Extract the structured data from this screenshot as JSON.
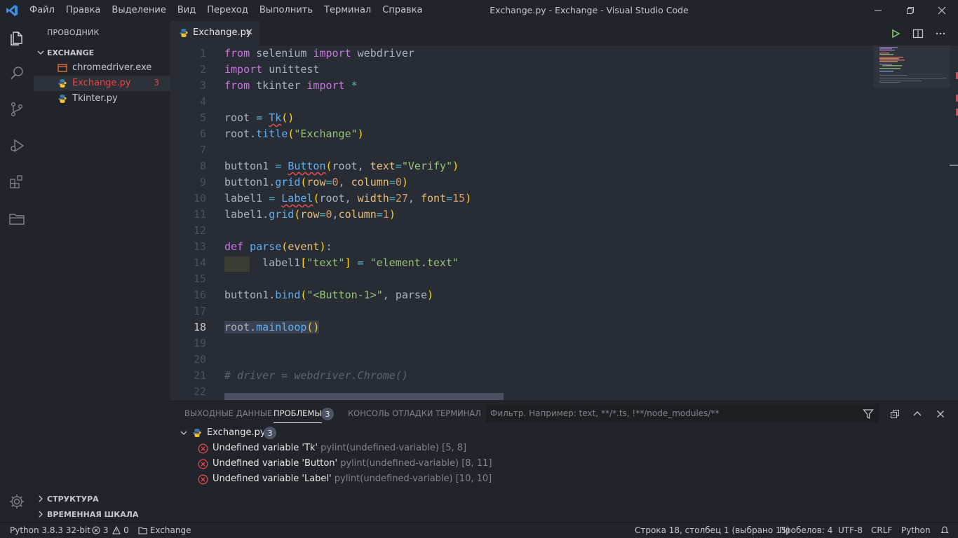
{
  "titlebar": {
    "menu": [
      "Файл",
      "Правка",
      "Выделение",
      "Вид",
      "Переход",
      "Выполнить",
      "Терминал",
      "Справка"
    ],
    "window_title": "Exchange.py - Exchange - Visual Studio Code"
  },
  "activitybar": {
    "items": [
      "explorer-icon",
      "search-icon",
      "source-control-icon",
      "run-debug-icon",
      "extensions-icon",
      "folder-icon"
    ],
    "bottom": "gear-icon"
  },
  "sidebar": {
    "title": "ПРОВОДНИК",
    "folder": "EXCHANGE",
    "files": [
      {
        "name": "chromedriver.exe",
        "icon": "exe-file-icon",
        "error": false
      },
      {
        "name": "Exchange.py",
        "icon": "python-icon",
        "error": true,
        "count": "3"
      },
      {
        "name": "Tkinter.py",
        "icon": "python-icon",
        "error": false
      }
    ],
    "outline": "СТРУКТУРА",
    "timeline": "ВРЕМЕННАЯ ШКАЛА"
  },
  "tabs": {
    "active": "Exchange.py",
    "actions": [
      "run-icon",
      "split-editor-icon",
      "more-icon"
    ]
  },
  "editor": {
    "line_numbers": [
      "1",
      "2",
      "3",
      "4",
      "5",
      "6",
      "7",
      "8",
      "9",
      "10",
      "11",
      "12",
      "13",
      "14",
      "15",
      "16",
      "17",
      "18",
      "19",
      "20",
      "21",
      "22"
    ]
  },
  "panel": {
    "tabs": [
      "ВЫХОДНЫЕ ДАННЫЕ",
      "ПРОБЛЕМЫ",
      "КОНСОЛЬ ОТЛАДКИ",
      "ТЕРМИНАЛ"
    ],
    "problems_count": "3",
    "filter_placeholder": "Фильтр. Например: text, **/*.ts, !**/node_modules/**",
    "file": "Exchange.py",
    "file_count": "3",
    "problems": [
      {
        "message": "Undefined variable 'Tk'",
        "source": "pylint(undefined-variable)",
        "pos": "[5, 8]"
      },
      {
        "message": "Undefined variable 'Button'",
        "source": "pylint(undefined-variable)",
        "pos": "[8, 11]"
      },
      {
        "message": "Undefined variable 'Label'",
        "source": "pylint(undefined-variable)",
        "pos": "[10, 10]"
      }
    ]
  },
  "statusbar": {
    "python": "Python 3.8.3 32-bit",
    "errors": "3",
    "warnings": "0",
    "folder": "Exchange",
    "cursor": "Строка 18, столбец 1 (выбрано 15)",
    "spaces": "Пробелов: 4",
    "encoding": "UTF-8",
    "eol": "CRLF",
    "language": "Python"
  },
  "colors": {
    "accent": "#3a8ee6",
    "error": "#e94545",
    "editor_bg": "#282c34",
    "chrome_bg": "#21252b"
  }
}
